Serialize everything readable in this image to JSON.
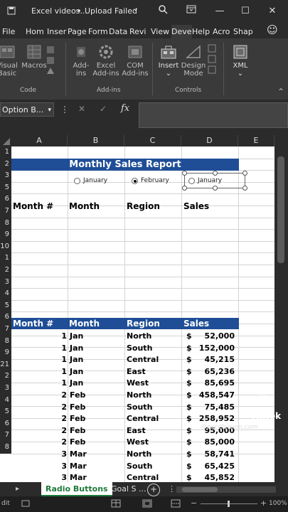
{
  "titlebar": {
    "doc_title": "Excel videos...",
    "separator": "•",
    "status": "Upload Failed",
    "status_chevron": "⌄"
  },
  "tabs": [
    "File",
    "Hom",
    "Inser",
    "Page",
    "Form",
    "Data",
    "Revi",
    "View",
    "Deve",
    "Help",
    "Acro",
    "Shap"
  ],
  "active_tab": "Deve",
  "ribbon": {
    "buttons": [
      {
        "label_1": "Visual",
        "label_2": "Basic",
        "icon": "visual-basic-icon"
      },
      {
        "label_1": "Macros",
        "label_2": "",
        "icon": "macros-icon"
      },
      {
        "label_1": "Add-",
        "label_2": "ins",
        "icon": "add-ins-icon"
      },
      {
        "label_1": "Excel",
        "label_2": "Add-ins",
        "icon": "excel-add-ins-icon"
      },
      {
        "label_1": "COM",
        "label_2": "Add-ins",
        "icon": "com-add-ins-icon"
      },
      {
        "label_1": "Insert",
        "label_2": "⌄",
        "icon": "insert-controls-icon"
      },
      {
        "label_1": "Design",
        "label_2": "Mode",
        "icon": "design-mode-icon"
      },
      {
        "label_1": "XML",
        "label_2": "⌄",
        "icon": "xml-icon"
      }
    ],
    "groups": [
      "Code",
      "Add-ins",
      "Controls"
    ]
  },
  "formula_bar": {
    "name_box": "Option B...",
    "name_box_chevron": "▾",
    "more": "⋮",
    "cancel": "✕",
    "enter": "✓",
    "fx": "fx",
    "value": ""
  },
  "columns": [
    "A",
    "B",
    "C",
    "D",
    "E"
  ],
  "row_numbers": [
    "1",
    "2",
    "3",
    "5",
    "6",
    "7",
    "8",
    "9",
    "10",
    "1",
    "2",
    "3",
    "4",
    "5",
    "6",
    "7",
    "8",
    "9",
    "21",
    "2",
    "3",
    "4",
    "5",
    "6",
    "7",
    "8"
  ],
  "report": {
    "title": "Monthly Sales Report",
    "radio_options": [
      {
        "label": "January",
        "selected": false
      },
      {
        "label": "February",
        "selected": true
      },
      {
        "label": "January",
        "selected": false
      }
    ],
    "summary_headers": [
      "Month #",
      "Month",
      "Region",
      "Sales"
    ],
    "table_headers": [
      "Month #",
      "Month",
      "Region",
      "Sales"
    ],
    "currency": "$",
    "rows": [
      [
        "1",
        "Jan",
        "North",
        "52,000"
      ],
      [
        "1",
        "Jan",
        "South",
        "152,000"
      ],
      [
        "1",
        "Jan",
        "Central",
        "45,215"
      ],
      [
        "1",
        "Jan",
        "East",
        "65,236"
      ],
      [
        "1",
        "Jan",
        "West",
        "85,695"
      ],
      [
        "2",
        "Feb",
        "North",
        "458,547"
      ],
      [
        "2",
        "Feb",
        "South",
        "75,485"
      ],
      [
        "2",
        "Feb",
        "Central",
        "258,952"
      ],
      [
        "2",
        "Feb",
        "East",
        "95,000"
      ],
      [
        "2",
        "Feb",
        "West",
        "85,000"
      ],
      [
        "3",
        "Mar",
        "North",
        "58,741"
      ],
      [
        "3",
        "Mar",
        "South",
        "65,425"
      ],
      [
        "3",
        "Mar",
        "Central",
        "45,852"
      ]
    ]
  },
  "sheets": {
    "active": "Radio Buttons",
    "other": "Goal S ...",
    "add": "+",
    "more": "⋮"
  },
  "statusbar": {
    "left": "dit",
    "zoom": "100%"
  },
  "watermark": {
    "brand": "TikTok",
    "handle": "@excelvision.com"
  },
  "colors": {
    "header_blue": "#1f4e96",
    "tab_underline": "#4aa3ff",
    "sheet_tab_green": "#1e7a3a"
  }
}
